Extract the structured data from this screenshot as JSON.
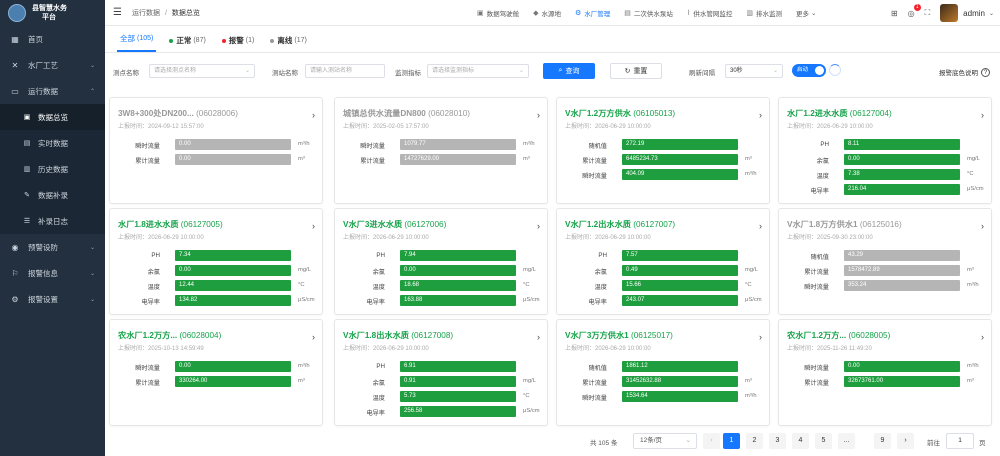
{
  "app": {
    "brand_line1": "县智慧水务",
    "brand_line2": "平台"
  },
  "sidebar": {
    "items": [
      {
        "label": "首页",
        "icon": "grid-icon"
      },
      {
        "label": "水厂工艺",
        "icon": "gear-x-icon"
      },
      {
        "label": "运行数据",
        "icon": "monitor-icon"
      }
    ],
    "subitems": [
      {
        "label": "数据总览"
      },
      {
        "label": "实时数据"
      },
      {
        "label": "历史数据"
      },
      {
        "label": "数据补录"
      },
      {
        "label": "补录日志"
      }
    ],
    "items2": [
      {
        "label": "预警设防"
      },
      {
        "label": "报警信息"
      },
      {
        "label": "报警设置"
      }
    ]
  },
  "header": {
    "breadcrumb": [
      "运行数据",
      "数据总览"
    ],
    "nav": [
      "数据驾驶舱",
      "水源地",
      "水厂管理",
      "二次供水泵站",
      "供水管网监控",
      "排水监测",
      "更多"
    ],
    "badge_count": "1",
    "user": "admin"
  },
  "tabs": [
    {
      "label": "全部",
      "count": "(105)"
    },
    {
      "label": "正常",
      "count": "(87)",
      "color": "#16a34a"
    },
    {
      "label": "报警",
      "count": "(1)",
      "color": "#f5222d"
    },
    {
      "label": "离线",
      "count": "(17)",
      "color": "#999999"
    }
  ],
  "filter": {
    "station_label": "测点名称",
    "station_placeholder": "请选择测点名称",
    "site_label": "测站名称",
    "site_placeholder": "请输入测站名称",
    "indicator_label": "监测指标",
    "indicator_placeholder": "请选择监测指标",
    "query": "查询",
    "reset": "重置",
    "interval_label": "刷新间隔",
    "interval_value": "30秒",
    "toggle_label": "启动",
    "legend_help": "报警底色说明"
  },
  "cards": [
    {
      "title": "3W8+300处DN200...",
      "code": "(06028006)",
      "time": "上报时间：2024-09-12 15:57:00",
      "status": "offline",
      "rows": [
        {
          "label": "瞬时流量",
          "value": "0.00",
          "unit": "m³/h"
        },
        {
          "label": "累计流量",
          "value": "0.00",
          "unit": "m³"
        }
      ]
    },
    {
      "title": "城镇总供水流量DN800",
      "code": "(06028010)",
      "time": "上报时间：2025-02-05 17:57:00",
      "status": "offline",
      "rows": [
        {
          "label": "瞬时流量",
          "value": "1079.77",
          "unit": "m³/h"
        },
        {
          "label": "累计流量",
          "value": "14727629.00",
          "unit": "m³"
        }
      ]
    },
    {
      "title": "V水厂1.2万方供水",
      "code": "(06105013)",
      "time": "上报时间：2026-06-29 10:00:00",
      "status": "normal",
      "rows": [
        {
          "label": "随机值",
          "value": "272.19",
          "unit": ""
        },
        {
          "label": "累计流量",
          "value": "6485234.73",
          "unit": "m³"
        },
        {
          "label": "瞬时流量",
          "value": "404.09",
          "unit": "m³/h"
        }
      ]
    },
    {
      "title": "水厂1.2进水水质",
      "code": "(06127004)",
      "time": "上报时间：2026-06-29 10:00:00",
      "status": "normal",
      "rows": [
        {
          "label": "PH",
          "value": "8.11",
          "unit": ""
        },
        {
          "label": "余氯",
          "value": "0.00",
          "unit": "mg/L"
        },
        {
          "label": "温度",
          "value": "7.38",
          "unit": "°C"
        },
        {
          "label": "电导率",
          "value": "216.04",
          "unit": "μS/cm"
        }
      ]
    },
    {
      "title": "水厂1.8进水水质",
      "code": "(06127005)",
      "time": "上报时间：2026-06-29 10:00:00",
      "status": "normal",
      "rows": [
        {
          "label": "PH",
          "value": "7.34",
          "unit": ""
        },
        {
          "label": "余氯",
          "value": "0.00",
          "unit": "mg/L"
        },
        {
          "label": "温度",
          "value": "12.44",
          "unit": "°C"
        },
        {
          "label": "电导率",
          "value": "134.82",
          "unit": "μS/cm"
        }
      ]
    },
    {
      "title": "V水厂3进水水质",
      "code": "(06127006)",
      "time": "上报时间：2026-06-29 10:00:00",
      "status": "normal",
      "rows": [
        {
          "label": "PH",
          "value": "7.94",
          "unit": ""
        },
        {
          "label": "余氯",
          "value": "0.00",
          "unit": "mg/L"
        },
        {
          "label": "温度",
          "value": "18.68",
          "unit": "°C"
        },
        {
          "label": "电导率",
          "value": "163.88",
          "unit": "μS/cm"
        }
      ]
    },
    {
      "title": "V水厂1.2出水水质",
      "code": "(06127007)",
      "time": "上报时间：2026-06-29 10:00:00",
      "status": "normal",
      "rows": [
        {
          "label": "PH",
          "value": "7.57",
          "unit": ""
        },
        {
          "label": "余氯",
          "value": "0.49",
          "unit": "mg/L"
        },
        {
          "label": "温度",
          "value": "15.66",
          "unit": "°C"
        },
        {
          "label": "电导率",
          "value": "243.07",
          "unit": "μS/cm"
        }
      ]
    },
    {
      "title": "V水厂1.8万方供水1",
      "code": "(06125016)",
      "time": "上报时间：2025-09-30 23:00:00",
      "status": "offline",
      "rows": [
        {
          "label": "随机值",
          "value": "43.29",
          "unit": ""
        },
        {
          "label": "累计流量",
          "value": "1578472.89",
          "unit": "m³"
        },
        {
          "label": "瞬时流量",
          "value": "353.24",
          "unit": "m³/h"
        }
      ]
    },
    {
      "title": "农水厂1.2万方...",
      "code": "(06028004)",
      "time": "上报时间：2025-10-13 14:59:49",
      "status": "normal",
      "rows": [
        {
          "label": "瞬时流量",
          "value": "0.00",
          "unit": "m³/h"
        },
        {
          "label": "累计流量",
          "value": "330264.00",
          "unit": "m³"
        }
      ]
    },
    {
      "title": "V水厂1.8出水水质",
      "code": "(06127008)",
      "time": "上报时间：2026-06-29 10:00:00",
      "status": "normal",
      "rows": [
        {
          "label": "PH",
          "value": "6.91",
          "unit": ""
        },
        {
          "label": "余氯",
          "value": "0.91",
          "unit": "mg/L"
        },
        {
          "label": "温度",
          "value": "5.73",
          "unit": "°C"
        },
        {
          "label": "电导率",
          "value": "256.58",
          "unit": "μS/cm"
        }
      ]
    },
    {
      "title": "V水厂3万方供水1",
      "code": "(06125017)",
      "time": "上报时间：2026-06-29 10:00:00",
      "status": "normal",
      "rows": [
        {
          "label": "随机值",
          "value": "1861.12",
          "unit": ""
        },
        {
          "label": "累计流量",
          "value": "31452632.88",
          "unit": "m³"
        },
        {
          "label": "瞬时流量",
          "value": "1534.64",
          "unit": "m³/h"
        }
      ]
    },
    {
      "title": "农水厂1.2万方...",
      "code": "(06028005)",
      "time": "上报时间：2025-11-26 11:49:20",
      "status": "normal",
      "rows": [
        {
          "label": "瞬时流量",
          "value": "0.00",
          "unit": "m³/h"
        },
        {
          "label": "累计流量",
          "value": "32673761.00",
          "unit": "m³"
        }
      ]
    }
  ],
  "pagination": {
    "total": "共 105 条",
    "page_size": "12条/页",
    "pages": [
      "1",
      "2",
      "3",
      "4",
      "5",
      "...",
      "9"
    ],
    "current": "1",
    "goto_label": "前往",
    "goto_value": "1",
    "goto_unit": "页"
  },
  "colors": {
    "accent": "#1677ff",
    "normal": "#1e9e3e",
    "offline": "#b5b5b5",
    "sidebar": "#22303f"
  }
}
